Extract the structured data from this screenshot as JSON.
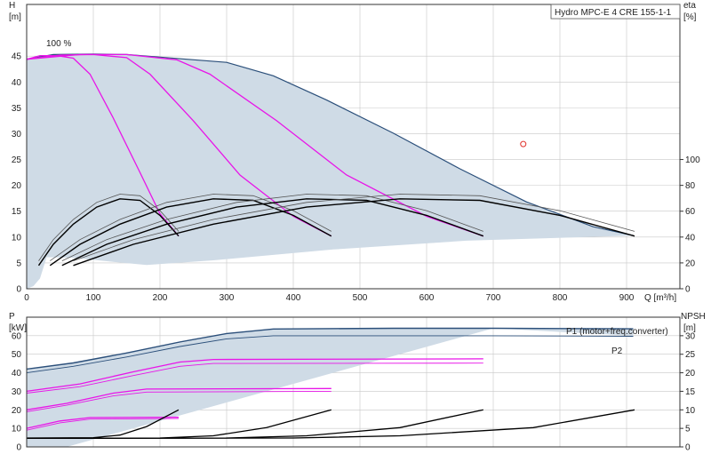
{
  "title_box": "Hydro MPC-E 4 CRE 155-1-1",
  "colors": {
    "envelope_fill": "#cfdbe6",
    "envelope_edge": "#2b4f7a",
    "speed_curve": "#e815e8",
    "efficiency": "#000000",
    "grid": "#c8c8c8",
    "marker": "#e0302a"
  },
  "chart_data": [
    {
      "type": "line",
      "name": "qh",
      "xlabel": "Q [m³/h]",
      "y_left_label": "H",
      "y_left_unit": "[m]",
      "y_right_label": "eta",
      "y_right_unit": "[%]",
      "xlim": [
        0,
        980
      ],
      "ylim": [
        0,
        55
      ],
      "x_ticks": [
        0,
        100,
        200,
        300,
        400,
        500,
        600,
        700,
        800,
        900
      ],
      "y_ticks": [
        0,
        5,
        10,
        15,
        20,
        25,
        30,
        35,
        40,
        45
      ],
      "y_right_ticks": [
        0,
        20,
        40,
        60,
        80,
        100
      ],
      "y_right_scale": "eta 0–100 % spans H 0–25 m",
      "speed_label": "100 %",
      "envelope": [
        [
          0,
          44.4
        ],
        [
          40,
          45.3
        ],
        [
          100,
          45.4
        ],
        [
          150,
          45.3
        ],
        [
          200,
          44.8
        ],
        [
          300,
          43.8
        ],
        [
          370,
          41.2
        ],
        [
          450,
          36.5
        ],
        [
          550,
          30.1
        ],
        [
          650,
          23.2
        ],
        [
          750,
          16.8
        ],
        [
          850,
          12.0
        ],
        [
          910,
          10.3
        ],
        [
          660,
          9.3
        ],
        [
          460,
          7.6
        ],
        [
          280,
          5.5
        ],
        [
          180,
          4.6
        ],
        [
          130,
          5.2
        ],
        [
          70,
          6.0
        ],
        [
          30,
          6.1
        ],
        [
          20,
          2.0
        ],
        [
          10,
          0.5
        ],
        [
          0,
          0
        ]
      ],
      "series": [
        {
          "name": "",
          "kind": "qh",
          "points": [
            [
              0,
              44.4
            ],
            [
              20,
              45.1
            ],
            [
              45,
              45.1
            ],
            [
              70,
              44.6
            ],
            [
              95,
              41.5
            ],
            [
              130,
              33.0
            ],
            [
              170,
              22.5
            ],
            [
              200,
              14.5
            ],
            [
              228,
              10.2
            ]
          ]
        },
        {
          "name": "",
          "kind": "qh",
          "points": [
            [
              0,
              44.4
            ],
            [
              50,
              45.2
            ],
            [
              100,
              45.3
            ],
            [
              150,
              44.7
            ],
            [
              185,
              41.5
            ],
            [
              250,
              32.5
            ],
            [
              320,
              22.0
            ],
            [
              400,
              14.0
            ],
            [
              457,
              10.2
            ]
          ]
        },
        {
          "name": "",
          "kind": "qh",
          "points": [
            [
              0,
              44.4
            ],
            [
              80,
              45.3
            ],
            [
              150,
              45.3
            ],
            [
              225,
              44.3
            ],
            [
              275,
              41.5
            ],
            [
              375,
              32.5
            ],
            [
              480,
              22.0
            ],
            [
              600,
              14.0
            ],
            [
              685,
              10.2
            ]
          ]
        },
        {
          "name": "",
          "kind": "eta",
          "points": [
            [
              18,
              4.5
            ],
            [
              40,
              8.6
            ],
            [
              70,
              12.5
            ],
            [
              105,
              15.8
            ],
            [
              140,
              17.4
            ],
            [
              170,
              17.1
            ],
            [
              200,
              14.2
            ],
            [
              228,
              10.2
            ]
          ]
        },
        {
          "name": "",
          "kind": "eta",
          "points": [
            [
              35,
              4.5
            ],
            [
              80,
              8.6
            ],
            [
              140,
              12.5
            ],
            [
              210,
              15.8
            ],
            [
              280,
              17.4
            ],
            [
              340,
              17.1
            ],
            [
              400,
              14.2
            ],
            [
              457,
              10.2
            ]
          ]
        },
        {
          "name": "",
          "kind": "eta",
          "points": [
            [
              53,
              4.5
            ],
            [
              120,
              8.6
            ],
            [
              210,
              12.5
            ],
            [
              315,
              15.8
            ],
            [
              420,
              17.4
            ],
            [
              510,
              17.1
            ],
            [
              600,
              14.2
            ],
            [
              685,
              10.2
            ]
          ]
        },
        {
          "name": "",
          "kind": "eta",
          "points": [
            [
              70,
              4.5
            ],
            [
              160,
              8.6
            ],
            [
              280,
              12.5
            ],
            [
              420,
              15.8
            ],
            [
              560,
              17.4
            ],
            [
              680,
              17.1
            ],
            [
              800,
              14.2
            ],
            [
              912,
              10.2
            ]
          ]
        }
      ],
      "marker": [
        745,
        28
      ]
    },
    {
      "type": "line",
      "name": "power",
      "y_left_label": "P",
      "y_left_unit": "[kW]",
      "y_right_label": "NPSH",
      "y_right_unit": "[m]",
      "xlim": [
        0,
        980
      ],
      "ylim": [
        0,
        70
      ],
      "y_ticks": [
        0,
        10,
        20,
        30,
        40,
        50,
        60
      ],
      "y_right_ticks": [
        0,
        5,
        10,
        15,
        20,
        25,
        30
      ],
      "y_right_scale": "NPSH 0–30 m spans P 0–60 kW",
      "legend": [
        "P1 (motor+freq.converter)",
        "P2"
      ],
      "envelope": [
        [
          0,
          41.5
        ],
        [
          60,
          45
        ],
        [
          150,
          50.5
        ],
        [
          300,
          61
        ],
        [
          370,
          63.5
        ],
        [
          550,
          64
        ],
        [
          700,
          64
        ],
        [
          910,
          63.5
        ],
        [
          910,
          60
        ],
        [
          700,
          64
        ],
        [
          60,
          0
        ],
        [
          0,
          0
        ]
      ],
      "series": [
        {
          "name": "P1 (motor+freq.converter)",
          "kind": "p1",
          "points": [
            [
              0,
              42
            ],
            [
              70,
              45.3
            ],
            [
              150,
              50.7
            ],
            [
              230,
              56.6
            ],
            [
              300,
              61.2
            ],
            [
              370,
              63.6
            ],
            [
              550,
              64
            ],
            [
              700,
              64
            ],
            [
              910,
              63.7
            ]
          ]
        },
        {
          "name": "P2",
          "kind": "p2",
          "points": [
            [
              0,
              40
            ],
            [
              70,
              43.5
            ],
            [
              150,
              48.5
            ],
            [
              230,
              54.2
            ],
            [
              300,
              58.3
            ],
            [
              370,
              60
            ],
            [
              550,
              60
            ],
            [
              700,
              60
            ],
            [
              910,
              59.7
            ]
          ]
        },
        {
          "name": "",
          "kind": "pp",
          "points": [
            [
              0,
              10
            ],
            [
              50,
              14
            ],
            [
              95,
              15.8
            ],
            [
              228,
              16
            ]
          ]
        },
        {
          "name": "",
          "kind": "pp",
          "points": [
            [
              0,
              20
            ],
            [
              60,
              23.5
            ],
            [
              130,
              29
            ],
            [
              180,
              31.2
            ],
            [
              457,
              31.5
            ]
          ]
        },
        {
          "name": "",
          "kind": "pp",
          "points": [
            [
              0,
              30
            ],
            [
              80,
              34
            ],
            [
              160,
              40.5
            ],
            [
              230,
              45.8
            ],
            [
              280,
              47.2
            ],
            [
              685,
              47.5
            ]
          ]
        },
        {
          "name": "",
          "kind": "pp2",
          "points": [
            [
              0,
              9
            ],
            [
              50,
              13
            ],
            [
              95,
              15
            ],
            [
              228,
              15.3
            ]
          ]
        },
        {
          "name": "",
          "kind": "pp2",
          "points": [
            [
              0,
              19
            ],
            [
              60,
              22.5
            ],
            [
              130,
              27.5
            ],
            [
              180,
              29.6
            ],
            [
              457,
              30
            ]
          ]
        },
        {
          "name": "",
          "kind": "pp2",
          "points": [
            [
              0,
              29
            ],
            [
              80,
              32.5
            ],
            [
              160,
              38.5
            ],
            [
              230,
              43.5
            ],
            [
              280,
              45
            ],
            [
              685,
              45.2
            ]
          ]
        },
        {
          "name": "",
          "kind": "npsh",
          "points": [
            [
              0,
              2.4
            ],
            [
              100,
              2.5
            ],
            [
              140,
              3.2
            ],
            [
              180,
              5.5
            ],
            [
              228,
              10
            ]
          ]
        },
        {
          "name": "",
          "kind": "npsh",
          "points": [
            [
              0,
              2.3
            ],
            [
              200,
              2.4
            ],
            [
              280,
              3
            ],
            [
              360,
              5.2
            ],
            [
              457,
              10
            ]
          ]
        },
        {
          "name": "",
          "kind": "npsh",
          "points": [
            [
              0,
              2.3
            ],
            [
              300,
              2.4
            ],
            [
              420,
              3
            ],
            [
              560,
              5.2
            ],
            [
              685,
              10
            ]
          ]
        },
        {
          "name": "",
          "kind": "npsh",
          "points": [
            [
              0,
              2.3
            ],
            [
              400,
              2.4
            ],
            [
              560,
              3
            ],
            [
              760,
              5.2
            ],
            [
              912,
              10
            ]
          ]
        }
      ]
    }
  ]
}
